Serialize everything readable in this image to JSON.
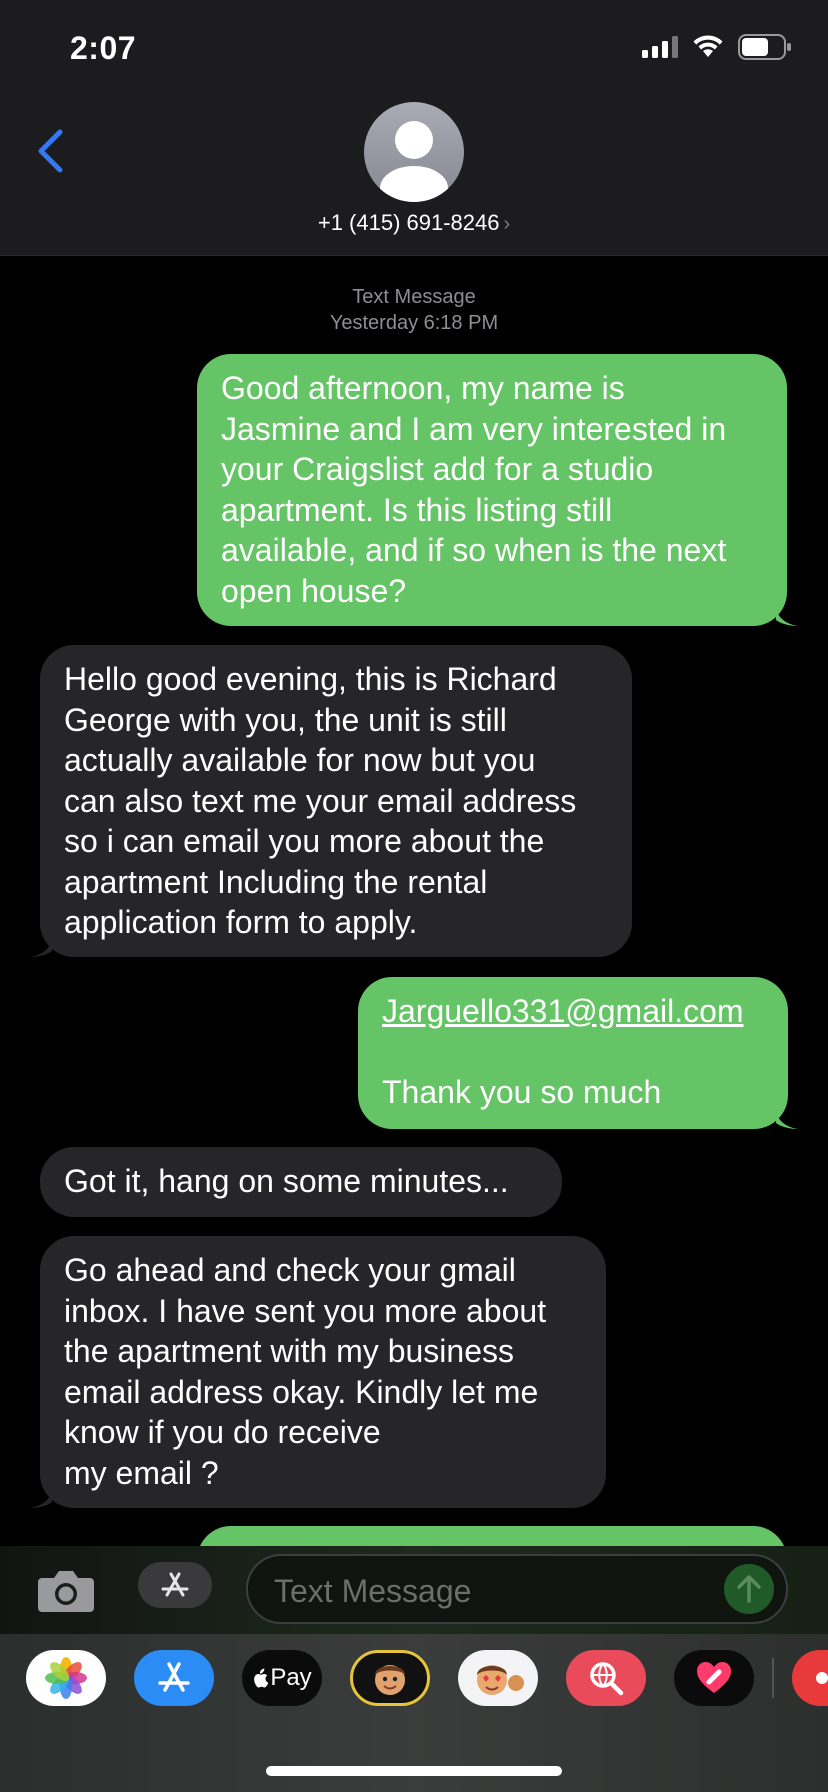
{
  "status_bar": {
    "time": "2:07"
  },
  "header": {
    "contact": "+1 (415) 691-8246",
    "chevron": "›"
  },
  "thread": {
    "service": "Text Message",
    "timestamp": "Yesterday 6:18 PM",
    "messages": [
      {
        "from": "me",
        "lines": [
          "Good afternoon, my name is",
          "Jasmine and I am very interested in",
          "your Craigslist add for a studio",
          "apartment. Is this listing still",
          "available, and if so when is the next",
          "open house?"
        ]
      },
      {
        "from": "them",
        "lines": [
          "Hello good evening, this is Richard",
          "George with you, the unit is still",
          "actually available for now but you",
          "can also text me your email address",
          "so i can email you more about the",
          "apartment Including the rental",
          "application form to apply."
        ]
      },
      {
        "from": "me",
        "link": "Jarguello331@gmail.com",
        "lines": [
          "Thank you so much"
        ]
      },
      {
        "from": "them",
        "lines": [
          "Got it, hang on some minutes..."
        ]
      },
      {
        "from": "them",
        "lines": [
          "Go ahead and check your gmail",
          "inbox. I have sent you more about",
          "the apartment with my business",
          "email address okay. Kindly let me",
          "know if you do receive",
          "my email ?"
        ]
      }
    ]
  },
  "input": {
    "placeholder": "Text Message"
  },
  "drawer": {
    "apps": [
      {
        "icon": "photos-icon"
      },
      {
        "icon": "app-store-icon"
      },
      {
        "icon": "apple-pay-icon",
        "label": "Pay"
      },
      {
        "icon": "memoji-icon"
      },
      {
        "icon": "memoji-stickers-icon"
      },
      {
        "icon": "search-images-icon"
      },
      {
        "icon": "digital-touch-icon"
      }
    ]
  },
  "colors": {
    "outgoing": "#65c466",
    "incoming": "#262628",
    "accent": "#3478f6"
  }
}
